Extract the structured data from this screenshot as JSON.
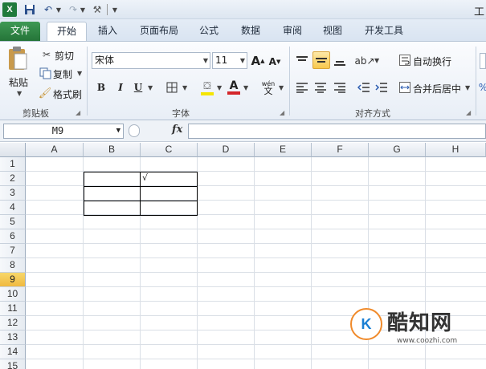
{
  "quick_access": {
    "title_fragment": "工"
  },
  "tabs": [
    "文件",
    "开始",
    "插入",
    "页面布局",
    "公式",
    "数据",
    "审阅",
    "视图",
    "开发工具"
  ],
  "clipboard": {
    "paste": "粘贴",
    "cut": "剪切",
    "copy": "复制",
    "format_painter": "格式刷",
    "group": "剪贴板"
  },
  "font": {
    "name": "宋体",
    "size": "11",
    "grow": "A",
    "shrink": "A",
    "bold": "B",
    "italic": "I",
    "underline": "U",
    "font_color_letter": "A",
    "phonetic": "wén",
    "group": "字体",
    "fill_color": "#f5e500",
    "text_color": "#d4262a"
  },
  "alignment": {
    "wrap_text": "自动换行",
    "merge_center": "合并后居中",
    "group": "对齐方式"
  },
  "formula_bar": {
    "name_box": "M9",
    "fx": "fx",
    "value": ""
  },
  "sheet": {
    "columns": [
      "A",
      "B",
      "C",
      "D",
      "E",
      "F",
      "G",
      "H"
    ],
    "rows": [
      "1",
      "2",
      "3",
      "4",
      "5",
      "6",
      "7",
      "8",
      "9",
      "10",
      "11",
      "12",
      "13",
      "14",
      "15"
    ],
    "selected_row": "9",
    "mark_c2": "√"
  },
  "watermark": {
    "brand": "酷知网",
    "url": "www.coozhi.com",
    "logo": "K"
  }
}
